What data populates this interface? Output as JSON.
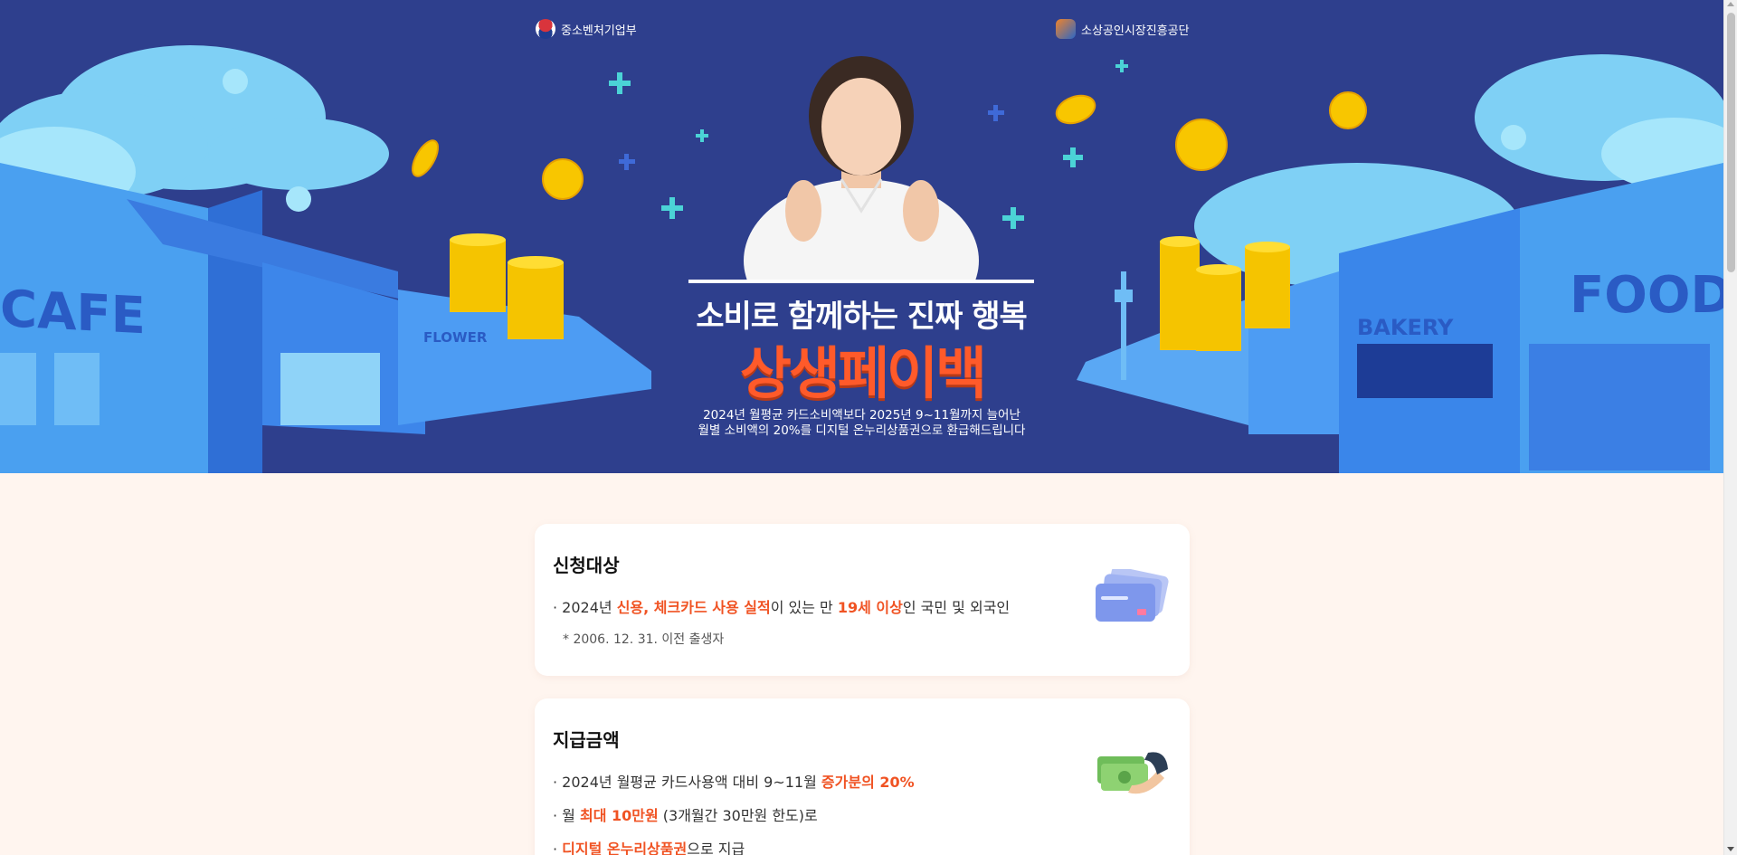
{
  "header": {
    "logo_left": "중소벤처기업부",
    "logo_right": "소상공인시장진흥공단"
  },
  "hero": {
    "headline": "소비로 함께하는 진짜 행복",
    "title": "상생페이백",
    "subtitle_line1": "2024년 월평균 카드소비액보다 2025년 9~11월까지 늘어난",
    "subtitle_line2": "월별 소비액의 20%를 디지털 온누리상품권으로 환급해드립니다",
    "storefront_left_1": "CAFE",
    "storefront_left_2": "FLOWER",
    "storefront_right_1": "BAKERY",
    "storefront_right_2": "FOOD"
  },
  "eligibility": {
    "title": "신청대상",
    "line_prefix": "· 2024년 ",
    "line_hl1": "신용, 체크카드 사용 실적",
    "line_mid": "이 있는 만 ",
    "line_hl2": "19세 이상",
    "line_suffix": "인 국민 및 외국인",
    "note": "* 2006. 12. 31. 이전 출생자"
  },
  "amount": {
    "title": "지급금액",
    "l1_prefix": "· 2024년 월평균 카드사용액 대비 9~11월 ",
    "l1_hl": "증가분의 20%",
    "l2_prefix": "· 월 ",
    "l2_hl": "최대 10만원",
    "l2_suffix": " (3개월간 30만원 한도)로",
    "l3_prefix": "· ",
    "l3_hl": "디지털 온누리상품권",
    "l3_suffix": "으로 지급"
  },
  "colors": {
    "hero_bg": "#2e3f8d",
    "accent": "#f05323",
    "page_bg": "#fff5ef"
  }
}
